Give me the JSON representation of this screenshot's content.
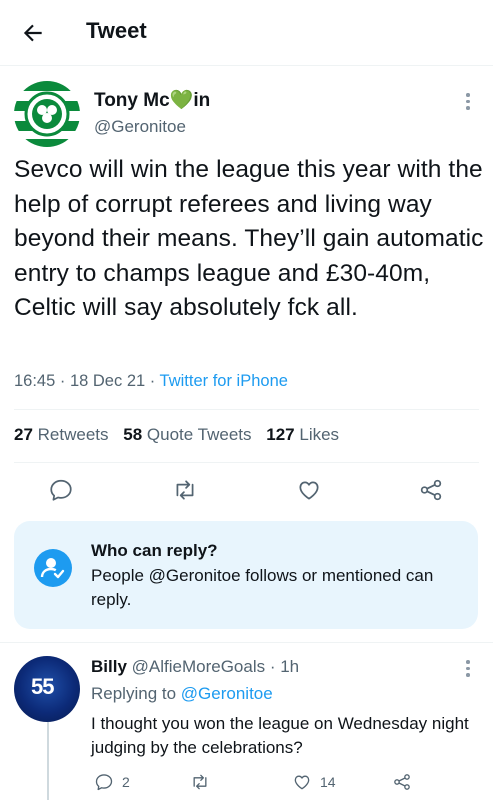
{
  "header": {
    "title": "Tweet"
  },
  "tweet": {
    "author_name_prefix": "Tony Mc",
    "author_name_emoji": "💚",
    "author_name_suffix": "in",
    "handle": "@Geronitoe",
    "text": "Sevco will win the league this year with the help of corrupt referees and living way beyond their means. They’ll gain automatic entry to champs league and £30-40m, Celtic will say absolutely fck all.",
    "time": "16:45 · 18 Dec 21 · ",
    "source": "Twitter for iPhone",
    "retweets_count": "27",
    "retweets_label": "Retweets",
    "quotes_count": "58",
    "quotes_label": "Quote Tweets",
    "likes_count": "127",
    "likes_label": "Likes"
  },
  "who_can_reply": {
    "title": "Who can reply?",
    "text": "People @Geronitoe follows or mentioned can reply."
  },
  "reply": {
    "name": "Billy",
    "handle": "@AlfieMoreGoals · 1h",
    "replying_prefix": "Replying to ",
    "replying_to": "@Geronitoe",
    "text": "I thought you won the league on Wednesday night judging by the celebrations?",
    "replies": "2",
    "likes": "14",
    "avatar_text": "55"
  },
  "colors": {
    "accent": "#1d9bf0",
    "secondary": "#536471",
    "border": "#eff3f4",
    "reply_box_bg": "#e8f5fd"
  },
  "icons": [
    "back-arrow-icon",
    "more-icon",
    "reply-icon",
    "retweet-icon",
    "like-icon",
    "share-icon",
    "person-check-icon"
  ]
}
